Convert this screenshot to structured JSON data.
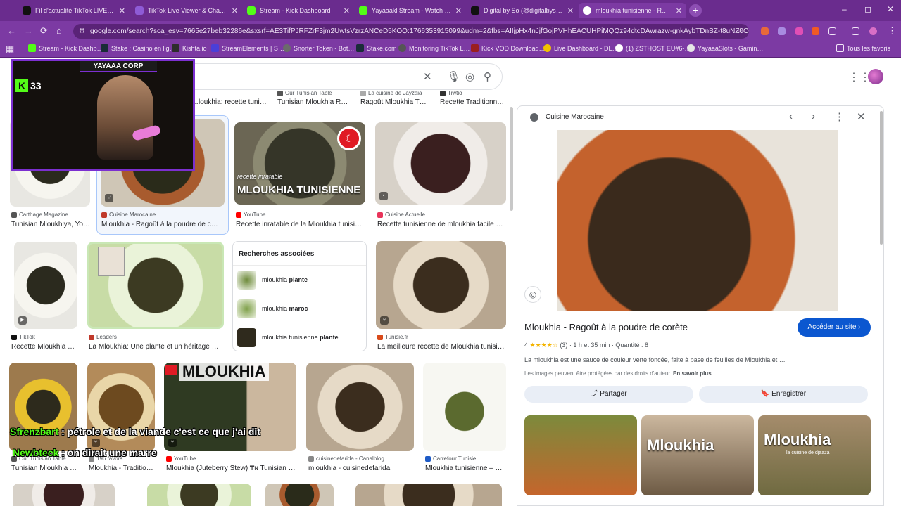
{
  "tabs": [
    {
      "label": "Fil d'actualité TikTok LIVE – Po…",
      "color": "#111111"
    },
    {
      "label": "TikTok Live Viewer & Chat Read…",
      "color": "#8e5bd6"
    },
    {
      "label": "Stream - Kick Dashboard",
      "color": "#53fc18"
    },
    {
      "label": "Yayaaakl Stream - Watch Live o…",
      "color": "#53fc18"
    },
    {
      "label": "Digital by So (@digitalbyso) est…",
      "color": "#111111"
    },
    {
      "label": "mloukhia tunisienne - Recherch…",
      "color": "#ffffff"
    }
  ],
  "window": {
    "minimize": "–",
    "maximize": "◻",
    "close": "✕"
  },
  "address": {
    "url": "google.com/search?sca_esv=7665e27beb32286e&sxsrf=AE3TifPJRFZrF3jm2UwtsVzrzANCeD5KOQ:1766353915099&udm=2&fbs=AIIjpHx4nJjfGojPVHhEACUHPiMQQz94dtcDAwrazw-gnkAybTDnBZ-t8uNZ0O2xCV01NRjRj…"
  },
  "bookmarks": [
    {
      "label": "Stream - Kick Dashb…",
      "color": "#53fc18"
    },
    {
      "label": "Stake : Casino en lig…",
      "color": "#1a2c38"
    },
    {
      "label": "Kishta.io",
      "color": "#2d2d2d"
    },
    {
      "label": "StreamElements | S…",
      "color": "#4b3fd8"
    },
    {
      "label": "Snorter Token - Bot…",
      "color": "#6b6b6b"
    },
    {
      "label": "Stake.com",
      "color": "#1a2c38"
    },
    {
      "label": "Monitoring TikTok L…",
      "color": "#555555"
    },
    {
      "label": "Kick VOD Download…",
      "color": "#9a1f1f"
    },
    {
      "label": "Live Dashboard - DL…",
      "color": "#f2c200"
    },
    {
      "label": "(1) ZSTHOST EU#6-…",
      "color": "#ffffff"
    },
    {
      "label": "YayaaaSlots - Gamin…",
      "color": "#e6e6e6"
    }
  ],
  "bookmarks_all": "Tous les favoris",
  "stream": {
    "brand": "YAYAAA CORP",
    "viewers": "33",
    "k": "K"
  },
  "top_captions": [
    {
      "title": "…loukhia: recette tunisi…"
    },
    {
      "source": "Our Tunisian Table",
      "title": "Tunisian Mloukhia R…"
    },
    {
      "source": "La cuisine de Jayzaia",
      "title": "Ragoût Mloukhia T…"
    },
    {
      "source": "Tiwtio",
      "title": "Recette Traditionn…"
    }
  ],
  "row1": [
    {
      "source": "Carthage Magazine",
      "title": "Tunisian Mloukhiya, Yo…",
      "color": "#555555"
    },
    {
      "source": "Cuisine Marocaine",
      "title": "Mloukhia - Ragoût à la poudre de cor…",
      "color": "#c0392b"
    },
    {
      "source": "YouTube",
      "title": "Recette inratable de la Mloukhia tunisie…",
      "color": "#ff0000",
      "overlay1": "recette inratable",
      "overlay2": "MLOUKHIA TUNISIENNE"
    },
    {
      "source": "Cuisine Actuelle",
      "title": "Recette tunisienne de mloukhia facile : …",
      "color": "#e8345a"
    }
  ],
  "row2": [
    {
      "source": "TikTok",
      "title": "Recette Mloukhia …",
      "color": "#111111"
    },
    {
      "source": "Leaders",
      "title": "La Mloukhia: Une plante et un héritage cu…",
      "color": "#c0392b"
    },
    {
      "source": "Tunisie.fr",
      "title": "La meilleure recette de Mloukhia tunisie…",
      "color": "#d94a1a"
    }
  ],
  "related": {
    "heading": "Recherches associées",
    "items": [
      {
        "base": "mloukhia ",
        "bold": "plante"
      },
      {
        "base": "mloukhia ",
        "bold": "maroc"
      },
      {
        "base": "mloukhia tunisienne ",
        "bold": "plante"
      }
    ]
  },
  "row3": [
    {
      "source": "Our Tunisian Table",
      "title": "Tunisian Mloukhia …",
      "color": "#555555"
    },
    {
      "source": "196 favors",
      "title": "Mloukhia - Traditio…",
      "color": "#888888"
    },
    {
      "source": "YouTube",
      "title": "Mloukhia (Juteberry Stew) ₸ɴ Tunisian C…",
      "color": "#ff0000",
      "overlay": "MLOUKHIA"
    },
    {
      "source": "cuisinedefarida - Canalblog",
      "title": "mloukhia - cuisinedefarida",
      "color": "#888888"
    },
    {
      "source": "Carrefour Tunisie",
      "title": "Mloukhia tunisienne – C…",
      "color": "#1e5bc6"
    }
  ],
  "chat": [
    {
      "user": "Sfrenzbart",
      "message": " : pétrole et de la viande c'est ce que j'ai dit"
    },
    {
      "user": "Newbteck",
      "message": " : on dirait une marre"
    }
  ],
  "panel": {
    "source": "Cuisine Marocaine",
    "title": "Mloukhia - Ragoût à la poudre de corète",
    "visit": "Accéder au site ›",
    "rating": "4",
    "stars": "★★★★☆",
    "reviews": "(3)",
    "duration": "1 h et 35 min",
    "quantity": "Quantité : 8",
    "description": "La mloukhia est une sauce de couleur verte foncée, faite à base de feuilles de Mloukhia et …",
    "rights": "Les images peuvent être protégées par des droits d'auteur.",
    "learn_more": "En savoir plus",
    "share": "Partager",
    "save": "Enregistrer",
    "thumb_word": "Mloukhia",
    "thumb_sub": "la cuisine de djaaza"
  }
}
